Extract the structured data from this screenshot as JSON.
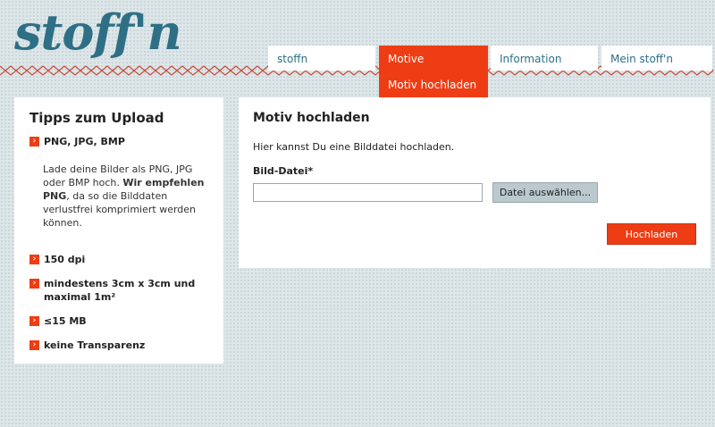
{
  "brand": {
    "logo_text": "stoff'n"
  },
  "nav": {
    "tabs": [
      {
        "label": "stoffn"
      },
      {
        "label": "Motive"
      },
      {
        "label": "Information"
      },
      {
        "label": "Mein stoff'n"
      }
    ],
    "active_subtab": "Motiv hochladen"
  },
  "tips": {
    "title": "Tipps zum Upload",
    "items": [
      {
        "label": "PNG, JPG, BMP"
      },
      {
        "label": "150 dpi"
      },
      {
        "label": "mindestens 3cm x 3cm und maximal 1m²"
      },
      {
        "label": "≤15 MB"
      },
      {
        "label": "keine Transparenz"
      }
    ],
    "format_text_1": "Lade deine Bilder als PNG, JPG oder BMP hoch. ",
    "format_text_bold": "Wir empfehlen PNG",
    "format_text_2": ", da so die Bilddaten verlustfrei komprimiert werden können."
  },
  "upload": {
    "title": "Motiv hochladen",
    "intro": "Hier kannst Du eine Bilddatei hochladen.",
    "field_label": "Bild-Datei*",
    "file_value": "",
    "choose_button": "Datei auswählen...",
    "submit_button": "Hochladen"
  },
  "colors": {
    "accent": "#ee3d14",
    "brand": "#2e6f86"
  }
}
